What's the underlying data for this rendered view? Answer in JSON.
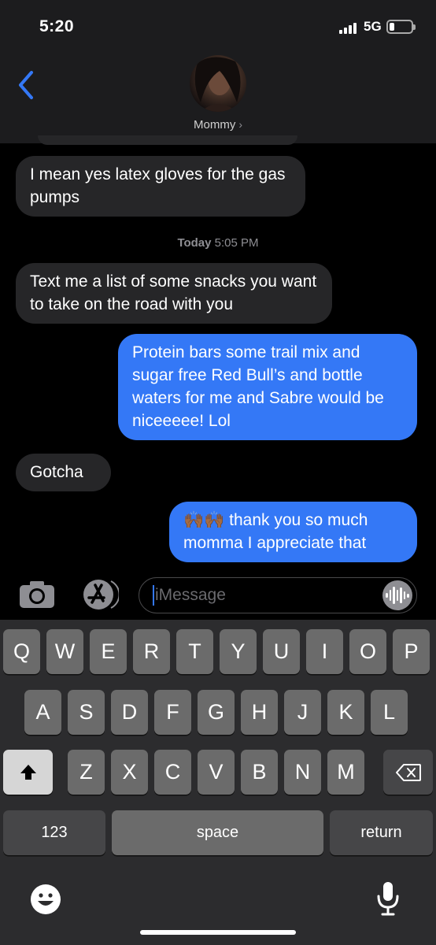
{
  "status_bar": {
    "time": "5:20",
    "network": "5G"
  },
  "header": {
    "contact_name": "Mommy",
    "chevron": "›"
  },
  "messages": [
    {
      "direction": "in",
      "text": "I mean yes latex gloves for the gas pumps"
    },
    {
      "direction": "in",
      "text": "Text me a list of some snacks you want to take on the road with you"
    },
    {
      "direction": "out",
      "text": "Protein bars some trail mix and sugar free Red Bull’s and bottle waters for me and Sabre  would be niceeeee! Lol"
    },
    {
      "direction": "in",
      "text": "Gotcha"
    },
    {
      "direction": "out",
      "emoji": "🙌🏾🙌🏾",
      "text": " thank you so much momma I appreciate that"
    }
  ],
  "timestamp": {
    "day": "Today",
    "time": "5:05 PM"
  },
  "input": {
    "placeholder": "iMessage"
  },
  "keyboard": {
    "row1": [
      "Q",
      "W",
      "E",
      "R",
      "T",
      "Y",
      "U",
      "I",
      "O",
      "P"
    ],
    "row2": [
      "A",
      "S",
      "D",
      "F",
      "G",
      "H",
      "J",
      "K",
      "L"
    ],
    "row3": [
      "Z",
      "X",
      "C",
      "V",
      "B",
      "N",
      "M"
    ],
    "numbers_label": "123",
    "space_label": "space",
    "return_label": "return"
  },
  "icons": [
    "back-chevron-icon",
    "camera-icon",
    "app-store-icon",
    "audio-waveform-icon",
    "shift-icon",
    "backspace-icon",
    "emoji-icon",
    "microphone-icon"
  ],
  "colors": {
    "outgoing_bubble": "#3478f6",
    "incoming_bubble": "#262628",
    "accent": "#3478f6"
  }
}
